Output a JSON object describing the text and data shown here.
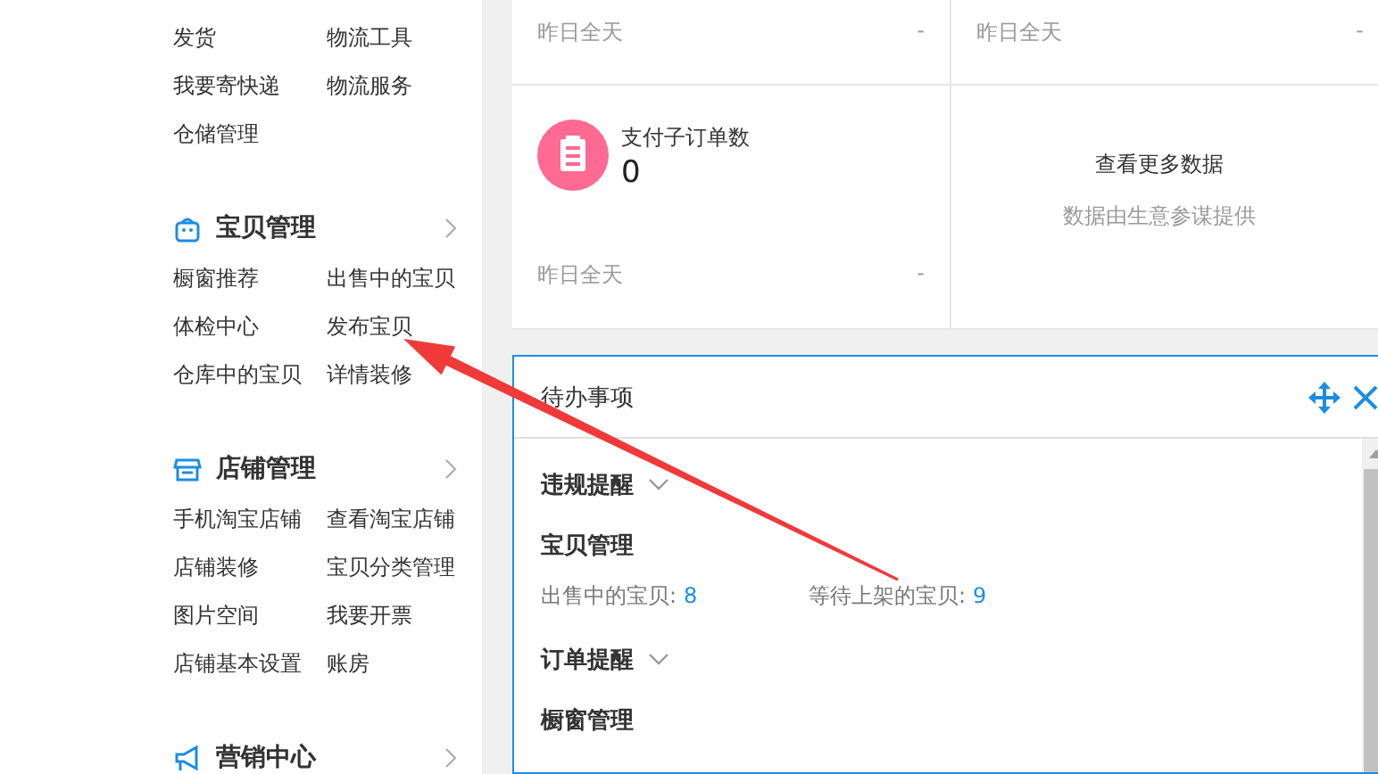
{
  "sidebar": {
    "sections": [
      {
        "items": [
          "发货",
          "物流工具",
          "我要寄快递",
          "物流服务",
          "仓储管理"
        ]
      },
      {
        "title": "宝贝管理",
        "kind": "bag",
        "items": [
          "橱窗推荐",
          "出售中的宝贝",
          "体检中心",
          "发布宝贝",
          "仓库中的宝贝",
          "详情装修"
        ]
      },
      {
        "title": "店铺管理",
        "kind": "shop",
        "items": [
          "手机淘宝店铺",
          "查看淘宝店铺",
          "店铺装修",
          "宝贝分类管理",
          "图片空间",
          "我要开票",
          "店铺基本设置",
          "账房"
        ]
      },
      {
        "title": "营销中心",
        "kind": "megaphone"
      }
    ]
  },
  "stat_cards": [
    {
      "kind": "footer",
      "period": "昨日全天",
      "value": "-"
    },
    {
      "kind": "footer",
      "period": "昨日全天",
      "value": "-"
    },
    {
      "kind": "metric",
      "title": "支付子订单数",
      "count": "0",
      "period": "昨日全天",
      "value": "-"
    },
    {
      "kind": "more",
      "title": "查看更多数据",
      "subtitle": "数据由生意参谋提供"
    }
  ],
  "todo_panel": {
    "title": "待办事项",
    "sections": [
      {
        "kind": "collapsible",
        "label": "违规提醒",
        "expanded": false
      },
      {
        "kind": "group",
        "label": "宝贝管理",
        "stats": [
          {
            "label": "出售中的宝贝:",
            "value": "8"
          },
          {
            "label": "等待上架的宝贝:",
            "value": "9"
          }
        ]
      },
      {
        "kind": "collapsible",
        "label": "订单提醒",
        "expanded": false
      },
      {
        "kind": "group",
        "label": "橱窗管理"
      }
    ]
  },
  "annotation": {
    "kind": "arrow"
  }
}
